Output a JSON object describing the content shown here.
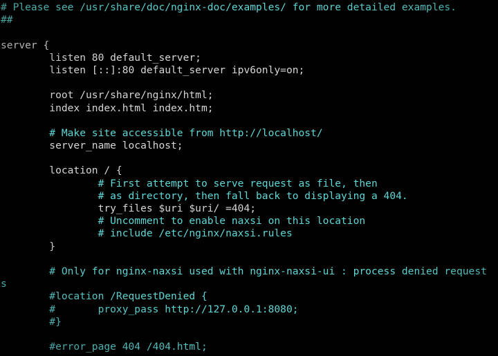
{
  "terminal": {
    "title": "nginx default site configuration",
    "background_color": "#000000",
    "comment_color": "#5fd7d7",
    "code_color": "#d6d6d6",
    "columns": 80,
    "rows": 28
  },
  "lines": [
    {
      "id": "l01",
      "kind": "comment",
      "text": "# Please see /usr/share/doc/nginx-doc/examples/ for more detailed examples."
    },
    {
      "id": "l02",
      "kind": "comment",
      "text": "##"
    },
    {
      "id": "l03",
      "kind": "blank",
      "text": ""
    },
    {
      "id": "l04",
      "kind": "code",
      "text": "server {"
    },
    {
      "id": "l05",
      "kind": "code",
      "text": "        listen 80 default_server;"
    },
    {
      "id": "l06",
      "kind": "code",
      "text": "        listen [::]:80 default_server ipv6only=on;"
    },
    {
      "id": "l07",
      "kind": "blank",
      "text": ""
    },
    {
      "id": "l08",
      "kind": "code",
      "text": "        root /usr/share/nginx/html;"
    },
    {
      "id": "l09",
      "kind": "code",
      "text": "        index index.html index.htm;"
    },
    {
      "id": "l10",
      "kind": "blank",
      "text": ""
    },
    {
      "id": "l11",
      "kind": "comment",
      "text": "        # Make site accessible from http://localhost/"
    },
    {
      "id": "l12",
      "kind": "code",
      "text": "        server_name localhost;"
    },
    {
      "id": "l13",
      "kind": "blank",
      "text": ""
    },
    {
      "id": "l14",
      "kind": "code",
      "text": "        location / {"
    },
    {
      "id": "l15",
      "kind": "comment",
      "text": "                # First attempt to serve request as file, then"
    },
    {
      "id": "l16",
      "kind": "comment",
      "text": "                # as directory, then fall back to displaying a 404."
    },
    {
      "id": "l17",
      "kind": "code",
      "text": "                try_files $uri $uri/ =404;"
    },
    {
      "id": "l18",
      "kind": "comment",
      "text": "                # Uncomment to enable naxsi on this location"
    },
    {
      "id": "l19",
      "kind": "comment",
      "text": "                # include /etc/nginx/naxsi.rules"
    },
    {
      "id": "l20",
      "kind": "code",
      "text": "        }"
    },
    {
      "id": "l21",
      "kind": "blank",
      "text": ""
    },
    {
      "id": "l22",
      "kind": "comment",
      "text": "        # Only for nginx-naxsi used with nginx-naxsi-ui : process denied request"
    },
    {
      "id": "l23",
      "kind": "comment",
      "text": "s"
    },
    {
      "id": "l24",
      "kind": "comment",
      "text": "        #location /RequestDenied {"
    },
    {
      "id": "l25",
      "kind": "comment",
      "text": "        #       proxy_pass http://127.0.0.1:8080;"
    },
    {
      "id": "l26",
      "kind": "comment",
      "text": "        #}"
    },
    {
      "id": "l27",
      "kind": "blank",
      "text": ""
    },
    {
      "id": "l28",
      "kind": "comment",
      "text": "        #error_page 404 /404.html;"
    }
  ]
}
